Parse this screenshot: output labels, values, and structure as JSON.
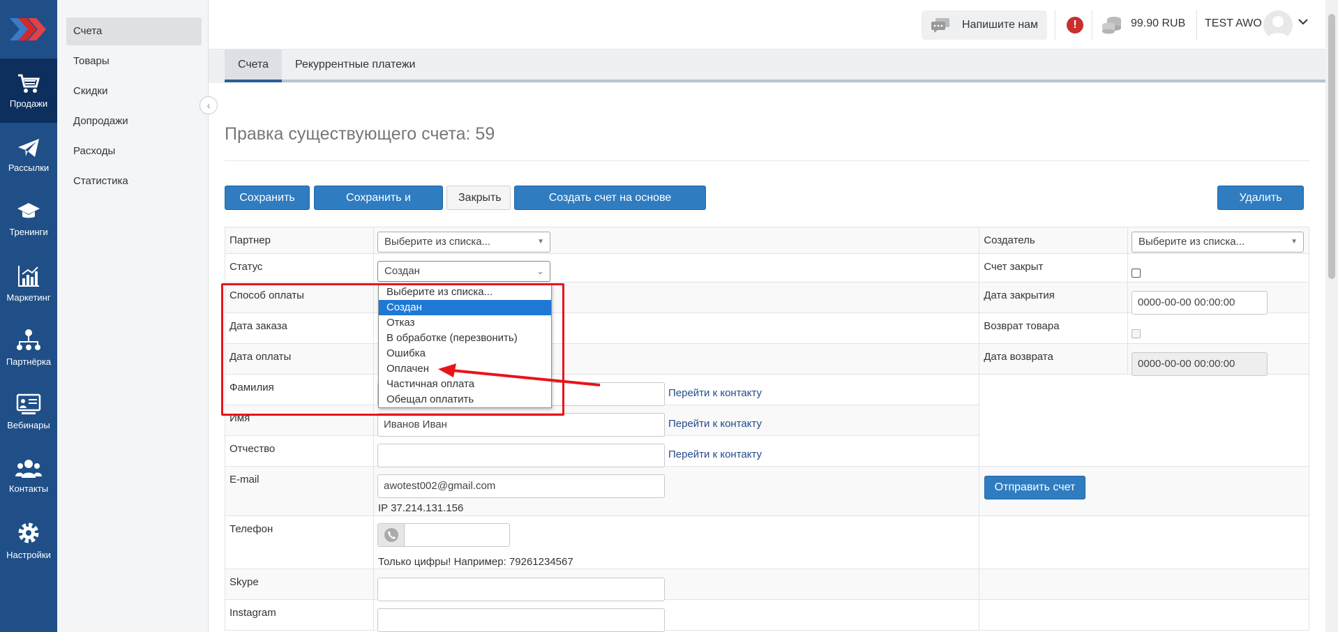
{
  "nav": {
    "items": [
      {
        "label": "Продажи",
        "icon": "cart-icon",
        "active": true
      },
      {
        "label": "Рассылки",
        "icon": "paper-plane-icon"
      },
      {
        "label": "Тренинги",
        "icon": "graduation-cap-icon"
      },
      {
        "label": "Маркетинг",
        "icon": "bar-chart-icon"
      },
      {
        "label": "Партнёрка",
        "icon": "sitemap-icon"
      },
      {
        "label": "Вебинары",
        "icon": "presentation-icon"
      },
      {
        "label": "Контакты",
        "icon": "users-icon"
      },
      {
        "label": "Настройки",
        "icon": "gear-icon"
      }
    ]
  },
  "submenu": {
    "items": [
      "Счета",
      "Товары",
      "Скидки",
      "Допродажи",
      "Расходы",
      "Статистика"
    ],
    "active": "Счета"
  },
  "topbar": {
    "chat_label": "Напишите нам",
    "alert": "!",
    "balance": "99.90 RUB",
    "user_name": "TEST AWO"
  },
  "tabs": [
    "Счета",
    "Рекуррентные платежи"
  ],
  "page_title": "Правка существующего счета: 59",
  "buttons": {
    "save": "Сохранить",
    "save_close": "Сохранить и закрыть",
    "close": "Закрыть",
    "create_from": "Создать счет на основе текущего",
    "delete": "Удалить"
  },
  "form": {
    "partner_label": "Партнер",
    "partner_value": "Выберите из списка...",
    "creator_label": "Создатель",
    "creator_value": "Выберите из списка...",
    "status_label": "Статус",
    "status_value": "Создан",
    "closed_label": "Счет закрыт",
    "payment_method_label": "Способ оплаты",
    "close_date_label": "Дата закрытия",
    "close_date_value": "0000-00-00 00:00:00",
    "order_date_label": "Дата заказа",
    "return_label": "Возврат товара",
    "pay_date_label": "Дата оплаты",
    "return_date_label": "Дата возврата",
    "return_date_value": "0000-00-00 00:00:00",
    "last_name_label": "Фамилия",
    "first_name_label": "Имя",
    "first_name_value": "Иванов Иван",
    "middle_name_label": "Отчество",
    "goto_contact": "Перейти к контакту",
    "email_label": "E-mail",
    "email_value": "awotest002@gmail.com",
    "ip_text": "IP 37.214.131.156",
    "send_invoice": "Отправить счет",
    "phone_label": "Телефон",
    "phone_hint": "Только цифры! Например: 79261234567",
    "skype_label": "Skype",
    "instagram_label": "Instagram"
  },
  "status_dropdown": {
    "options": [
      "Выберите из списка...",
      "Создан",
      "Отказ",
      "В обработке (перезвонить)",
      "Ошибка",
      "Оплачен",
      "Частичная оплата",
      "Обещал оплатить"
    ],
    "selected": "Создан"
  },
  "annotation": {
    "color": "#e8141b"
  }
}
